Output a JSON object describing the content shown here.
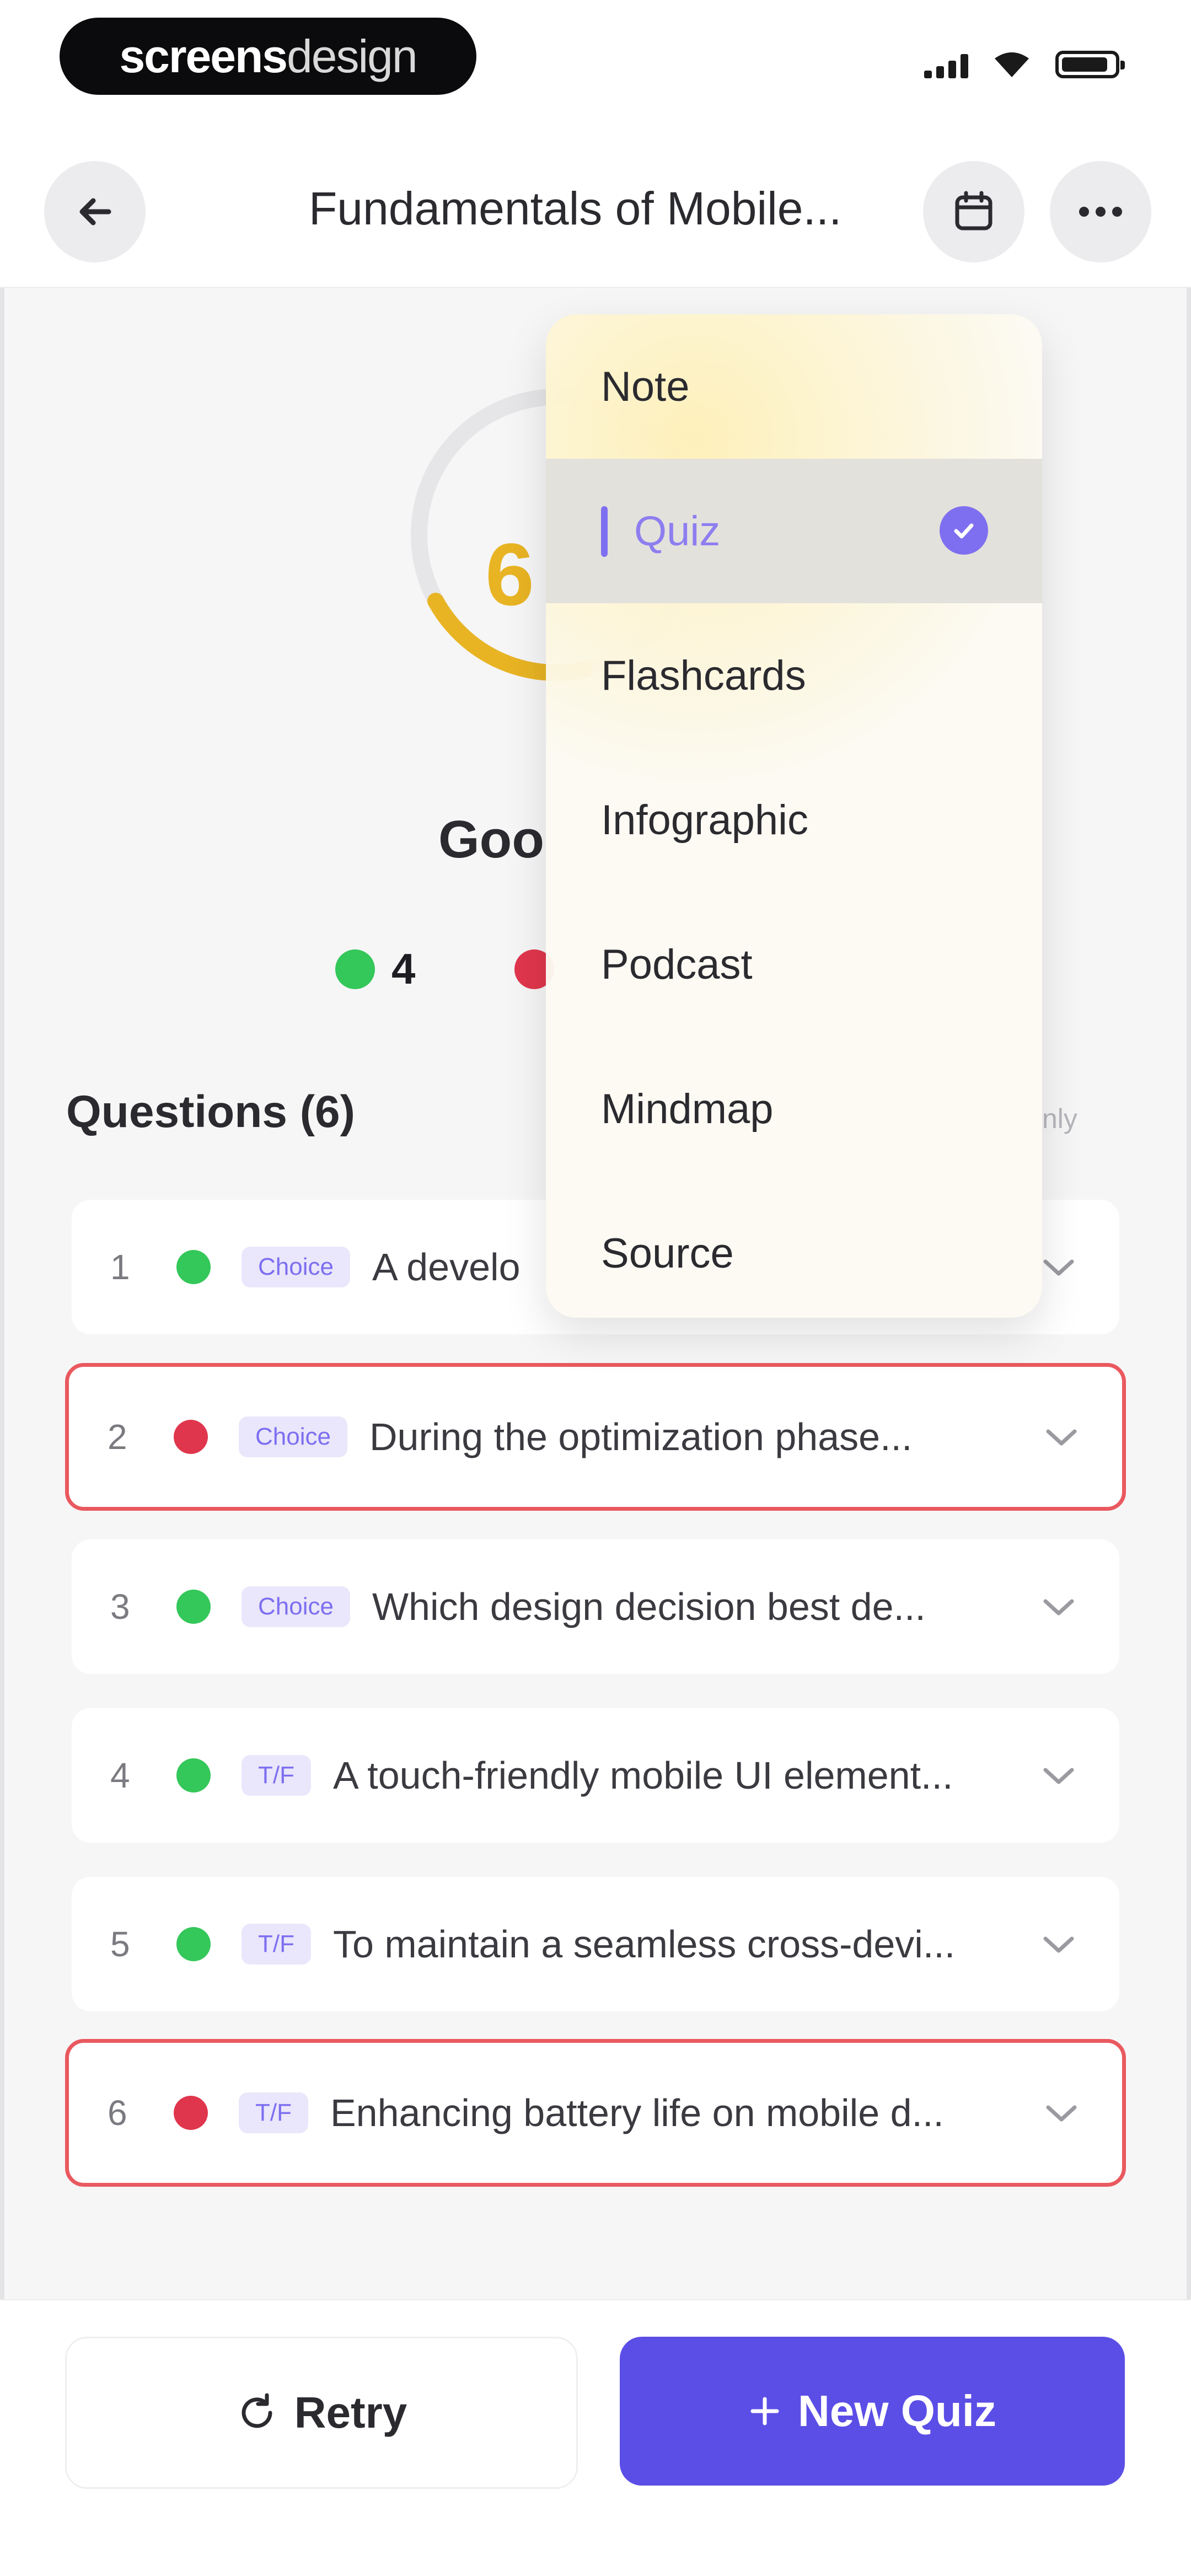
{
  "status_bar": {
    "brand_bold": "screens",
    "brand_light": "design"
  },
  "header": {
    "title": "Fundamentals of Mobile..."
  },
  "score": {
    "value": "6",
    "grade": "Goo",
    "correct_count": "4"
  },
  "questions": {
    "title": "Questions (6)",
    "filter_label": "nly",
    "items": [
      {
        "number": "1",
        "status": "correct",
        "tag": "Choice",
        "text": "A develo"
      },
      {
        "number": "2",
        "status": "wrong",
        "tag": "Choice",
        "text": "During the optimization phase..."
      },
      {
        "number": "3",
        "status": "correct",
        "tag": "Choice",
        "text": "Which design decision best de..."
      },
      {
        "number": "4",
        "status": "correct",
        "tag": "T/F",
        "text": "A touch-friendly mobile UI element..."
      },
      {
        "number": "5",
        "status": "correct",
        "tag": "T/F",
        "text": "To maintain a seamless cross-devi..."
      },
      {
        "number": "6",
        "status": "wrong",
        "tag": "T/F",
        "text": "Enhancing battery life on mobile d..."
      }
    ]
  },
  "menu": {
    "items": [
      {
        "label": "Note",
        "selected": false
      },
      {
        "label": "Quiz",
        "selected": true
      },
      {
        "label": "Flashcards",
        "selected": false
      },
      {
        "label": "Infographic",
        "selected": false
      },
      {
        "label": "Podcast",
        "selected": false
      },
      {
        "label": "Mindmap",
        "selected": false
      },
      {
        "label": "Source",
        "selected": false
      }
    ]
  },
  "footer": {
    "retry_label": "Retry",
    "new_quiz_label": "New Quiz"
  },
  "colors": {
    "accent": "#5b4ee6",
    "score": "#e8b423",
    "correct": "#34c759",
    "wrong": "#e0364d"
  },
  "icons": {
    "back": "arrow-left-icon",
    "calendar": "calendar-icon",
    "more": "more-horizontal-icon",
    "retry": "refresh-icon",
    "new_quiz": "plus-icon",
    "chevron": "chevron-down-icon",
    "check": "check-circle-icon"
  }
}
